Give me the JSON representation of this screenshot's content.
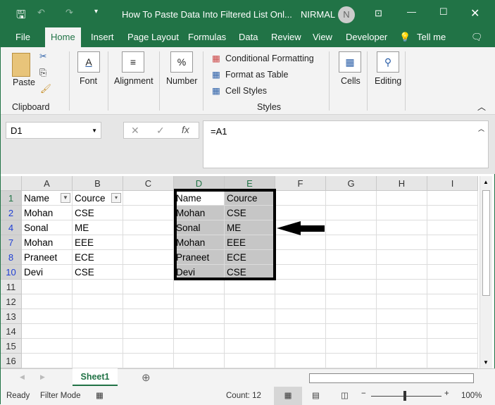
{
  "titlebar": {
    "title": "How To Paste Data Into Filtered List Onl...",
    "user": "NIRMAL",
    "avatar": "N"
  },
  "tabs": [
    "File",
    "Home",
    "Insert",
    "Page Layout",
    "Formulas",
    "Data",
    "Review",
    "View",
    "Developer",
    "Tell me"
  ],
  "ribbon": {
    "paste": "Paste",
    "clipboard": "Clipboard",
    "font": "Font",
    "alignment": "Alignment",
    "number": "Number",
    "cond_format": "Conditional Formatting",
    "format_table": "Format as Table",
    "cell_styles": "Cell Styles",
    "styles": "Styles",
    "cells": "Cells",
    "editing": "Editing"
  },
  "formula_bar": {
    "name_box": "D1",
    "formula": "=A1",
    "fx": "fx"
  },
  "columns": [
    "A",
    "B",
    "C",
    "D",
    "E",
    "F",
    "G",
    "H",
    "I"
  ],
  "rows": [
    {
      "n": "1",
      "cells": [
        "Name",
        "Cource",
        "",
        "Name",
        "Cource"
      ]
    },
    {
      "n": "2",
      "cells": [
        "Mohan",
        "CSE",
        "",
        "Mohan",
        "CSE"
      ]
    },
    {
      "n": "4",
      "cells": [
        "Sonal",
        "ME",
        "",
        "Sonal",
        "ME"
      ]
    },
    {
      "n": "7",
      "cells": [
        "Mohan",
        "EEE",
        "",
        "Mohan",
        "EEE"
      ]
    },
    {
      "n": "8",
      "cells": [
        "Praneet",
        "ECE",
        "",
        "Praneet",
        "ECE"
      ]
    },
    {
      "n": "10",
      "cells": [
        "Devi",
        "CSE",
        "",
        "Devi",
        "CSE"
      ]
    },
    {
      "n": "11",
      "cells": []
    },
    {
      "n": "12",
      "cells": []
    },
    {
      "n": "13",
      "cells": []
    },
    {
      "n": "14",
      "cells": []
    },
    {
      "n": "15",
      "cells": []
    },
    {
      "n": "16",
      "cells": []
    }
  ],
  "sheet": {
    "tab": "Sheet1"
  },
  "status": {
    "ready": "Ready",
    "mode": "Filter Mode",
    "count": "Count: 12",
    "zoom": "100%"
  }
}
